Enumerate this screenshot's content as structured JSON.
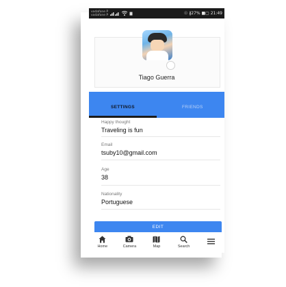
{
  "status_bar": {
    "carrier_top": "vodafone P",
    "carrier_bottom": "vodafone P",
    "battery_text": "☉ ∦27% ■▢ 21:49"
  },
  "profile": {
    "name": "Tiago Guerra"
  },
  "tabs": [
    {
      "label": "SETTINGS",
      "active": true
    },
    {
      "label": "FRIENDS",
      "active": false
    }
  ],
  "fields": [
    {
      "label": "Happy thought",
      "value": "Traveling is fun"
    },
    {
      "label": "Email",
      "value": "tsuby10@gmail.com"
    },
    {
      "label": "Age",
      "value": "38"
    },
    {
      "label": "Nationality",
      "value": "Portuguese"
    }
  ],
  "edit_button": {
    "label": "EDIT"
  },
  "bottom_nav": [
    {
      "label": "Home",
      "icon": "home-icon"
    },
    {
      "label": "Camera",
      "icon": "camera-icon"
    },
    {
      "label": "Map",
      "icon": "map-icon"
    },
    {
      "label": "Search",
      "icon": "search-icon"
    },
    {
      "label": "",
      "icon": "menu-icon"
    }
  ],
  "colors": {
    "accent": "#3d86f0",
    "status_bar": "#1a1a1a"
  }
}
